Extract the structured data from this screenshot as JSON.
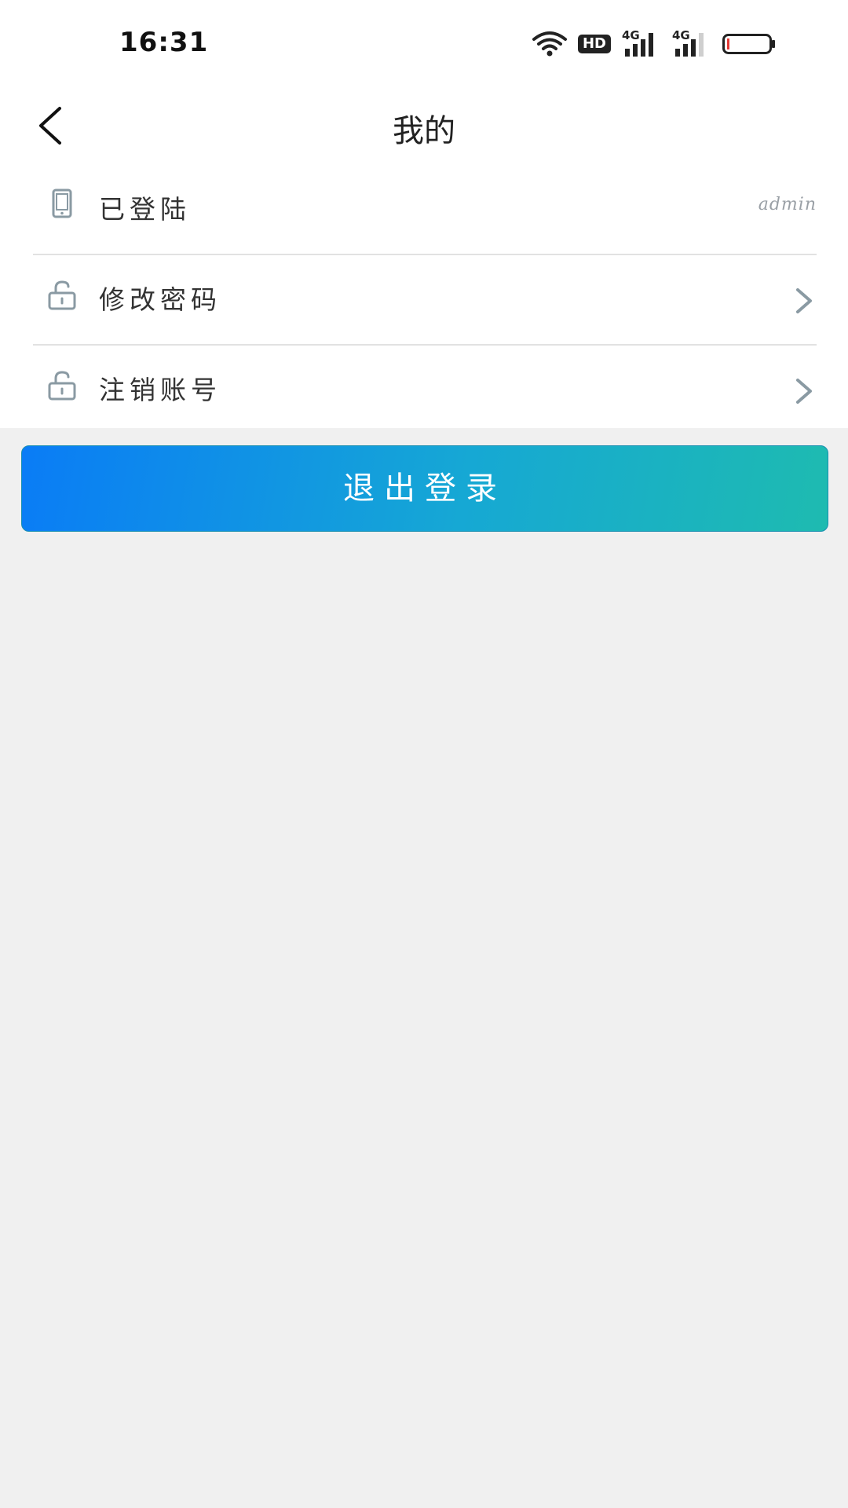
{
  "status_bar": {
    "time": "16:31",
    "hd_label": "HD",
    "signal1_label": "4G",
    "signal2_label": "4G"
  },
  "header": {
    "title": "我的"
  },
  "menu": {
    "items": [
      {
        "label": "已登陆",
        "value": "admin",
        "icon": "tablet-icon"
      },
      {
        "label": "修改密码",
        "icon": "lock-icon",
        "has_arrow": true
      },
      {
        "label": "注销账号",
        "icon": "lock-icon",
        "has_arrow": true
      }
    ]
  },
  "logout": {
    "label": "退出登录"
  },
  "colors": {
    "icon_gray": "#8a9aa3",
    "gradient_start": "#0a7cf6",
    "gradient_end": "#1ebbb0",
    "background": "#f0f0f0"
  }
}
